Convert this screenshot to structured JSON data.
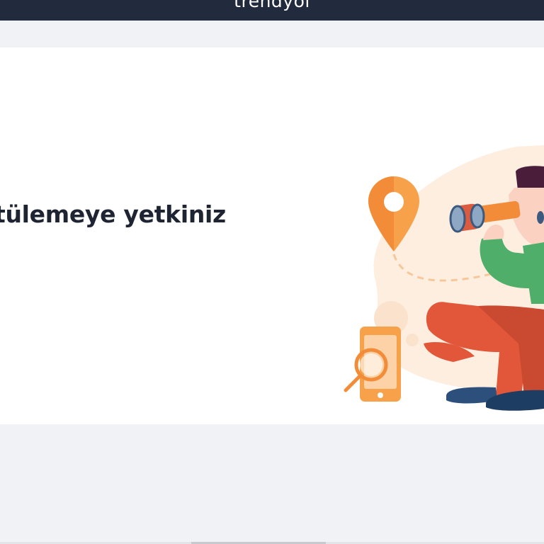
{
  "header": {
    "logo_text": "trendyol",
    "background": "#222a3e"
  },
  "main": {
    "message": "tülemeye yetkiniz",
    "illustration": "person-with-binoculars-illustration"
  },
  "colors": {
    "accent_orange": "#f28c38",
    "person_red": "#e2563a",
    "person_green": "#4fae6a",
    "page_bg": "#f1f2f6"
  }
}
